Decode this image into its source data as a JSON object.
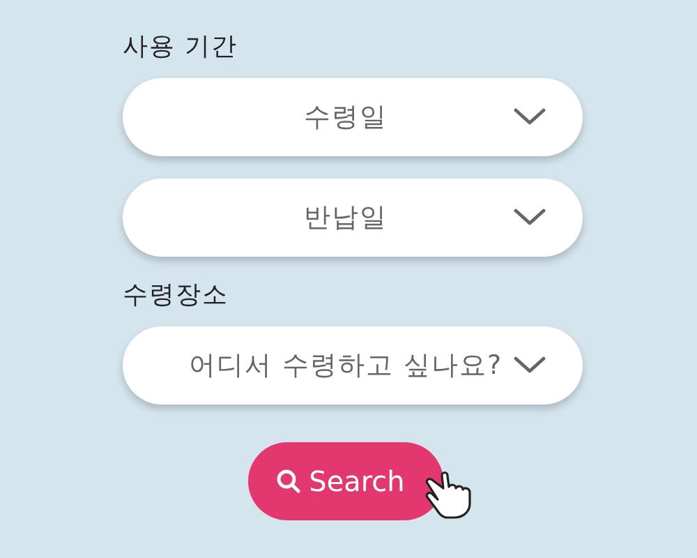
{
  "sections": [
    {
      "label": "사용 기간",
      "selects": [
        {
          "placeholder": "수령일"
        },
        {
          "placeholder": "반납일"
        }
      ]
    },
    {
      "label": "수령장소",
      "selects": [
        {
          "placeholder": "어디서 수령하고 싶나요?"
        }
      ]
    }
  ],
  "search_button": {
    "label": "Search"
  }
}
